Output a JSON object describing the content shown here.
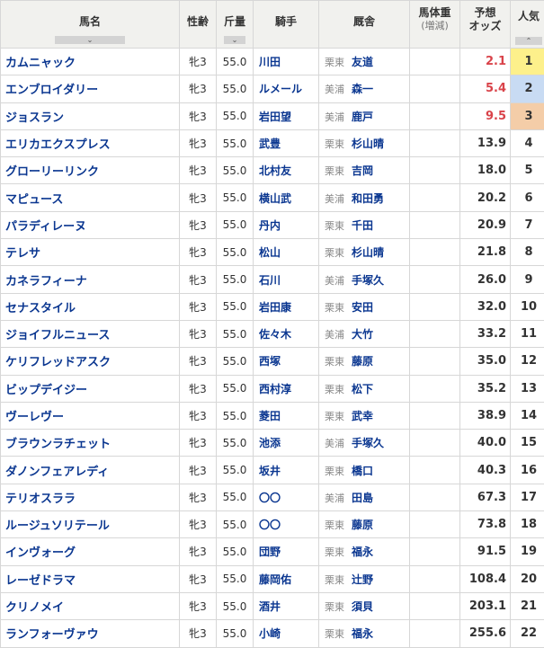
{
  "headers": {
    "name": "馬名",
    "sex_age": "性齢",
    "kinryo": "斤量",
    "jockey": "騎手",
    "stable": "厩舎",
    "weight_line1": "馬体重",
    "weight_line2": "(増減)",
    "odds_line1": "予想",
    "odds_line2": "オッズ",
    "popularity": "人気",
    "sort_down": "⌄",
    "sort_up": "⌃"
  },
  "highlight_colors": {
    "odds_top3": "#d9434a",
    "pop1": "#fdf08b",
    "pop2": "#c8dbf3",
    "pop3": "#f4cda8"
  },
  "horses": [
    {
      "name": "カムニャック",
      "sex_age": "牝3",
      "kinryo": "55.0",
      "jockey": "川田",
      "region": "栗東",
      "trainer": "友道",
      "odds": "2.1",
      "pop": "1"
    },
    {
      "name": "エンブロイダリー",
      "sex_age": "牝3",
      "kinryo": "55.0",
      "jockey": "ルメール",
      "region": "美浦",
      "trainer": "森一",
      "odds": "5.4",
      "pop": "2"
    },
    {
      "name": "ジョスラン",
      "sex_age": "牝3",
      "kinryo": "55.0",
      "jockey": "岩田望",
      "region": "美浦",
      "trainer": "鹿戸",
      "odds": "9.5",
      "pop": "3"
    },
    {
      "name": "エリカエクスプレス",
      "sex_age": "牝3",
      "kinryo": "55.0",
      "jockey": "武豊",
      "region": "栗東",
      "trainer": "杉山晴",
      "odds": "13.9",
      "pop": "4"
    },
    {
      "name": "グローリーリンク",
      "sex_age": "牝3",
      "kinryo": "55.0",
      "jockey": "北村友",
      "region": "栗東",
      "trainer": "吉岡",
      "odds": "18.0",
      "pop": "5"
    },
    {
      "name": "マピュース",
      "sex_age": "牝3",
      "kinryo": "55.0",
      "jockey": "横山武",
      "region": "美浦",
      "trainer": "和田勇",
      "odds": "20.2",
      "pop": "6"
    },
    {
      "name": "パラディレーヌ",
      "sex_age": "牝3",
      "kinryo": "55.0",
      "jockey": "丹内",
      "region": "栗東",
      "trainer": "千田",
      "odds": "20.9",
      "pop": "7"
    },
    {
      "name": "テレサ",
      "sex_age": "牝3",
      "kinryo": "55.0",
      "jockey": "松山",
      "region": "栗東",
      "trainer": "杉山晴",
      "odds": "21.8",
      "pop": "8"
    },
    {
      "name": "カネラフィーナ",
      "sex_age": "牝3",
      "kinryo": "55.0",
      "jockey": "石川",
      "region": "美浦",
      "trainer": "手塚久",
      "odds": "26.0",
      "pop": "9"
    },
    {
      "name": "セナスタイル",
      "sex_age": "牝3",
      "kinryo": "55.0",
      "jockey": "岩田康",
      "region": "栗東",
      "trainer": "安田",
      "odds": "32.0",
      "pop": "10"
    },
    {
      "name": "ジョイフルニュース",
      "sex_age": "牝3",
      "kinryo": "55.0",
      "jockey": "佐々木",
      "region": "美浦",
      "trainer": "大竹",
      "odds": "33.2",
      "pop": "11"
    },
    {
      "name": "ケリフレッドアスク",
      "sex_age": "牝3",
      "kinryo": "55.0",
      "jockey": "西塚",
      "region": "栗東",
      "trainer": "藤原",
      "odds": "35.0",
      "pop": "12"
    },
    {
      "name": "ビップデイジー",
      "sex_age": "牝3",
      "kinryo": "55.0",
      "jockey": "西村淳",
      "region": "栗東",
      "trainer": "松下",
      "odds": "35.2",
      "pop": "13"
    },
    {
      "name": "ヴーレヴー",
      "sex_age": "牝3",
      "kinryo": "55.0",
      "jockey": "菱田",
      "region": "栗東",
      "trainer": "武幸",
      "odds": "38.9",
      "pop": "14"
    },
    {
      "name": "ブラウンラチェット",
      "sex_age": "牝3",
      "kinryo": "55.0",
      "jockey": "池添",
      "region": "美浦",
      "trainer": "手塚久",
      "odds": "40.0",
      "pop": "15"
    },
    {
      "name": "ダノンフェアレディ",
      "sex_age": "牝3",
      "kinryo": "55.0",
      "jockey": "坂井",
      "region": "栗東",
      "trainer": "橋口",
      "odds": "40.3",
      "pop": "16"
    },
    {
      "name": "テリオスララ",
      "sex_age": "牝3",
      "kinryo": "55.0",
      "jockey": "〇〇",
      "region": "美浦",
      "trainer": "田島",
      "odds": "67.3",
      "pop": "17"
    },
    {
      "name": "ルージュソリテール",
      "sex_age": "牝3",
      "kinryo": "55.0",
      "jockey": "〇〇",
      "region": "栗東",
      "trainer": "藤原",
      "odds": "73.8",
      "pop": "18"
    },
    {
      "name": "インヴォーグ",
      "sex_age": "牝3",
      "kinryo": "55.0",
      "jockey": "団野",
      "region": "栗東",
      "trainer": "福永",
      "odds": "91.5",
      "pop": "19"
    },
    {
      "name": "レーゼドラマ",
      "sex_age": "牝3",
      "kinryo": "55.0",
      "jockey": "藤岡佑",
      "region": "栗東",
      "trainer": "辻野",
      "odds": "108.4",
      "pop": "20"
    },
    {
      "name": "クリノメイ",
      "sex_age": "牝3",
      "kinryo": "55.0",
      "jockey": "酒井",
      "region": "栗東",
      "trainer": "須貝",
      "odds": "203.1",
      "pop": "21"
    },
    {
      "name": "ランフォーヴァウ",
      "sex_age": "牝3",
      "kinryo": "55.0",
      "jockey": "小崎",
      "region": "栗東",
      "trainer": "福永",
      "odds": "255.6",
      "pop": "22"
    }
  ]
}
